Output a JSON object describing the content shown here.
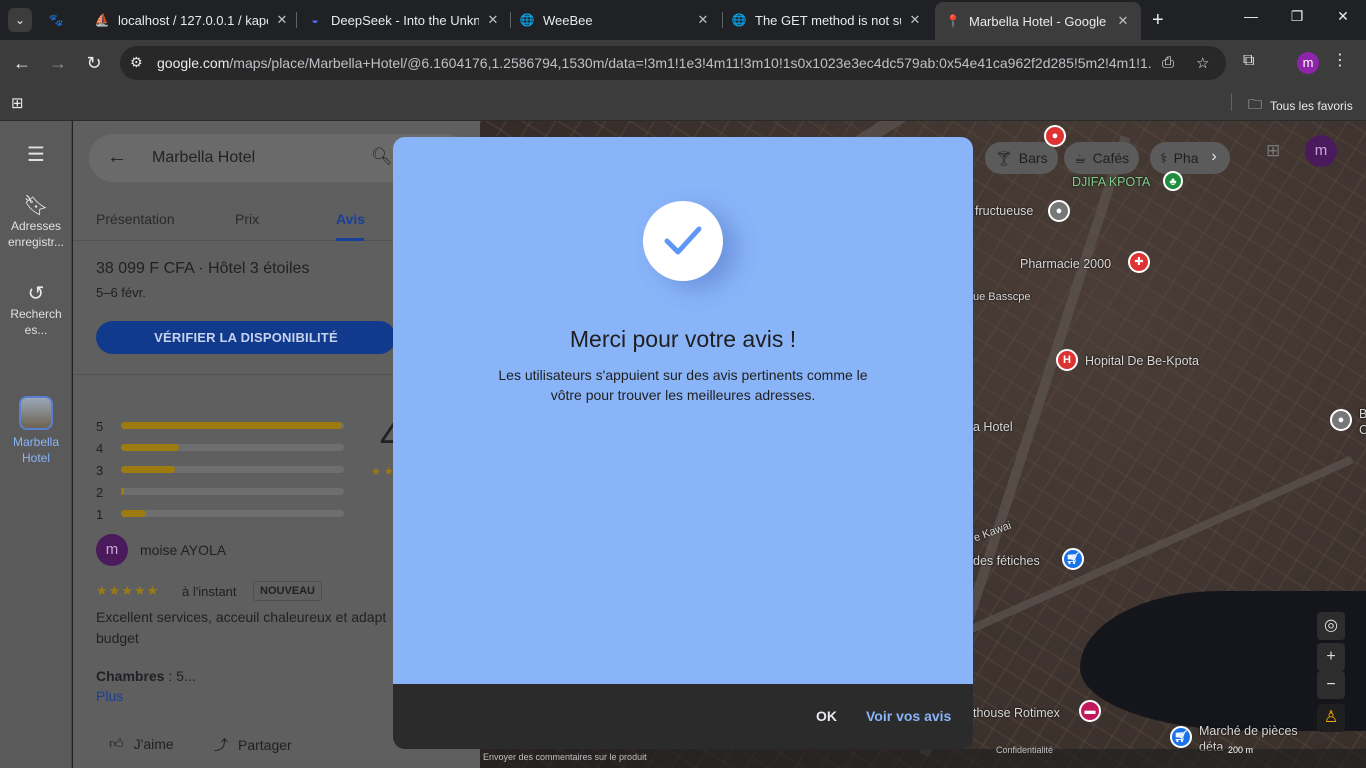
{
  "browser": {
    "tabs": [
      {
        "title": "localhost / 127.0.0.1 / kape",
        "icon": "phpmyadmin-icon"
      },
      {
        "title": "DeepSeek - Into the Unkno",
        "icon": "deepseek-icon"
      },
      {
        "title": "WeeBee",
        "icon": "globe-icon"
      },
      {
        "title": "The GET method is not sup",
        "icon": "globe-icon"
      },
      {
        "title": "Marbella Hotel - Google M",
        "icon": "google-maps-icon"
      }
    ],
    "url_host": "google.com",
    "url_path": "/maps/place/Marbella+Hotel/@6.1604176,1.2586794,1530m/data=!3m1!1e3!4m11!3m10!1s0x1023e3ec4dc579ab:0x54e41ca962f2d285!5m2!4m1!1...",
    "profile_initial": "m",
    "bookmarks_all": "Tous les favoris"
  },
  "rail": {
    "saved": "Adresses enregistr...",
    "recent": "Recherch es...",
    "hotel": "Marbella Hotel"
  },
  "panel": {
    "search_value": "Marbella Hotel",
    "tabs": [
      "Présentation",
      "Prix",
      "Avis"
    ],
    "price_line": "38 099 F CFA · Hôtel 3 étoiles",
    "dates": "5–6 févr.",
    "check_button": "VÉRIFIER LA DISPONIBILITÉ",
    "score": "4",
    "ratings": [
      {
        "star": "5",
        "fraction": 0.99
      },
      {
        "star": "4",
        "fraction": 0.26
      },
      {
        "star": "3",
        "fraction": 0.24
      },
      {
        "star": "2",
        "fraction": 0.01
      },
      {
        "star": "1",
        "fraction": 0.11
      }
    ],
    "review": {
      "avatar": "m",
      "author": "moise AYOLA",
      "stars": "★★★★★",
      "time": "à l'instant",
      "badge": "NOUVEAU",
      "text": "Excellent services, acceuil chaleureux et adapt budget",
      "rooms_label": "Chambres",
      "rooms_value": " : 5...",
      "more": "Plus",
      "like": "J'aime",
      "share": "Partager"
    }
  },
  "map": {
    "chips": [
      "Bars",
      "Cafés",
      "Pha"
    ],
    "labels": {
      "djifa": "DJIFA KPOTA",
      "fructueuse": "fructueuse",
      "pharmacie": "Pharmacie 2000",
      "basscpe": "ue Basscpe",
      "hopital": "Hopital De Be-Kpota",
      "hotel": "a Hotel",
      "kawai": "e Kawai",
      "fetiches": "des fétiches",
      "rotimex": "thouse Rotimex",
      "marche": "Marché de pièces",
      "marche2": "déta",
      "be": "B",
      "be2": "C"
    },
    "footer": {
      "feedback": "Envoyer des commentaires sur le produit",
      "confidentiality": "Confidentialité",
      "scale": "200 m"
    }
  },
  "dialog": {
    "title": "Merci pour votre avis !",
    "text": "Les utilisateurs s'appuient sur des avis pertinents comme le vôtre pour trouver les meilleures adresses.",
    "ok": "OK",
    "see_reviews": "Voir vos avis"
  },
  "colors": {
    "dialog_bg": "#8ab4f8",
    "dialog_footer": "#2b2b2b",
    "accent_blue": "#8ab4f8",
    "star_gold": "#9c7c10",
    "profile_purple": "#8e24aa"
  }
}
